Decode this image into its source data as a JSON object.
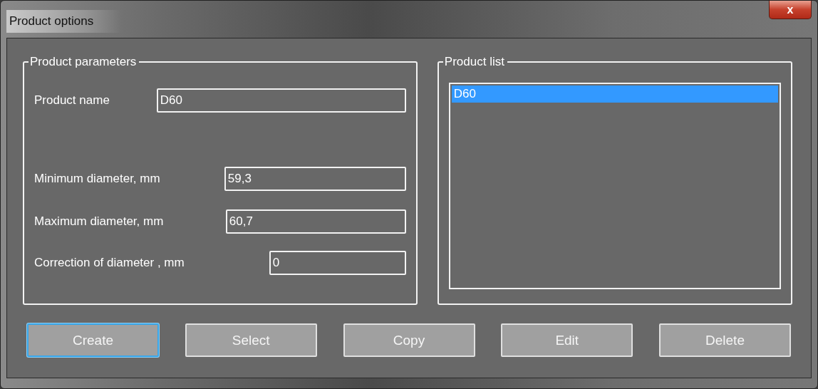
{
  "window": {
    "title": "Product options",
    "close_label": "x"
  },
  "parameters": {
    "title": "Product parameters",
    "fields": [
      {
        "label": "Product name",
        "value": "D60"
      },
      {
        "label": "Minimum diameter, mm",
        "value": "59,3"
      },
      {
        "label": "Maximum diameter, mm",
        "value": "60,7"
      },
      {
        "label": "Correction of diameter , mm",
        "value": "0"
      }
    ]
  },
  "product_list": {
    "title": "Product list",
    "items": [
      {
        "label": "D60",
        "selected": true
      }
    ]
  },
  "buttons": [
    {
      "label": "Create",
      "focused": true
    },
    {
      "label": "Select",
      "focused": false
    },
    {
      "label": "Copy",
      "focused": false
    },
    {
      "label": "Edit",
      "focused": false
    },
    {
      "label": "Delete",
      "focused": false
    }
  ]
}
